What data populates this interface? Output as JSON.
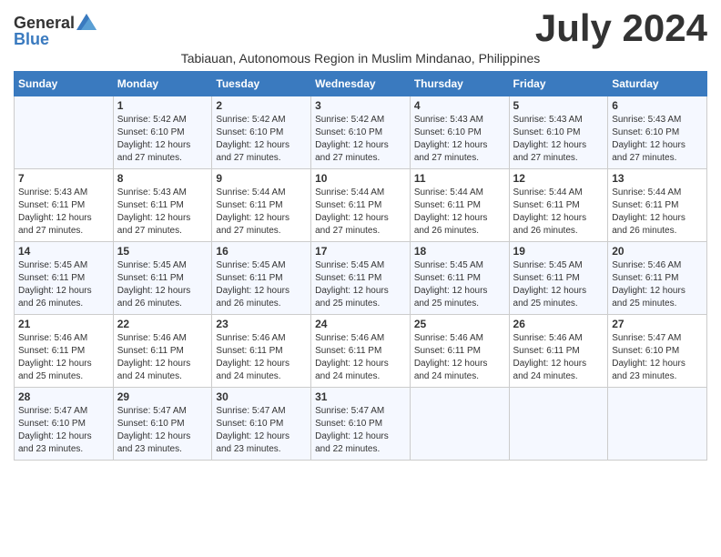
{
  "header": {
    "logo_general": "General",
    "logo_blue": "Blue",
    "month_title": "July 2024",
    "subtitle": "Tabiauan, Autonomous Region in Muslim Mindanao, Philippines"
  },
  "weekdays": [
    "Sunday",
    "Monday",
    "Tuesday",
    "Wednesday",
    "Thursday",
    "Friday",
    "Saturday"
  ],
  "weeks": [
    [
      {
        "day": "",
        "sunrise": "",
        "sunset": "",
        "daylight": ""
      },
      {
        "day": "1",
        "sunrise": "Sunrise: 5:42 AM",
        "sunset": "Sunset: 6:10 PM",
        "daylight": "Daylight: 12 hours and 27 minutes."
      },
      {
        "day": "2",
        "sunrise": "Sunrise: 5:42 AM",
        "sunset": "Sunset: 6:10 PM",
        "daylight": "Daylight: 12 hours and 27 minutes."
      },
      {
        "day": "3",
        "sunrise": "Sunrise: 5:42 AM",
        "sunset": "Sunset: 6:10 PM",
        "daylight": "Daylight: 12 hours and 27 minutes."
      },
      {
        "day": "4",
        "sunrise": "Sunrise: 5:43 AM",
        "sunset": "Sunset: 6:10 PM",
        "daylight": "Daylight: 12 hours and 27 minutes."
      },
      {
        "day": "5",
        "sunrise": "Sunrise: 5:43 AM",
        "sunset": "Sunset: 6:10 PM",
        "daylight": "Daylight: 12 hours and 27 minutes."
      },
      {
        "day": "6",
        "sunrise": "Sunrise: 5:43 AM",
        "sunset": "Sunset: 6:10 PM",
        "daylight": "Daylight: 12 hours and 27 minutes."
      }
    ],
    [
      {
        "day": "7",
        "sunrise": "Sunrise: 5:43 AM",
        "sunset": "Sunset: 6:11 PM",
        "daylight": "Daylight: 12 hours and 27 minutes."
      },
      {
        "day": "8",
        "sunrise": "Sunrise: 5:43 AM",
        "sunset": "Sunset: 6:11 PM",
        "daylight": "Daylight: 12 hours and 27 minutes."
      },
      {
        "day": "9",
        "sunrise": "Sunrise: 5:44 AM",
        "sunset": "Sunset: 6:11 PM",
        "daylight": "Daylight: 12 hours and 27 minutes."
      },
      {
        "day": "10",
        "sunrise": "Sunrise: 5:44 AM",
        "sunset": "Sunset: 6:11 PM",
        "daylight": "Daylight: 12 hours and 27 minutes."
      },
      {
        "day": "11",
        "sunrise": "Sunrise: 5:44 AM",
        "sunset": "Sunset: 6:11 PM",
        "daylight": "Daylight: 12 hours and 26 minutes."
      },
      {
        "day": "12",
        "sunrise": "Sunrise: 5:44 AM",
        "sunset": "Sunset: 6:11 PM",
        "daylight": "Daylight: 12 hours and 26 minutes."
      },
      {
        "day": "13",
        "sunrise": "Sunrise: 5:44 AM",
        "sunset": "Sunset: 6:11 PM",
        "daylight": "Daylight: 12 hours and 26 minutes."
      }
    ],
    [
      {
        "day": "14",
        "sunrise": "Sunrise: 5:45 AM",
        "sunset": "Sunset: 6:11 PM",
        "daylight": "Daylight: 12 hours and 26 minutes."
      },
      {
        "day": "15",
        "sunrise": "Sunrise: 5:45 AM",
        "sunset": "Sunset: 6:11 PM",
        "daylight": "Daylight: 12 hours and 26 minutes."
      },
      {
        "day": "16",
        "sunrise": "Sunrise: 5:45 AM",
        "sunset": "Sunset: 6:11 PM",
        "daylight": "Daylight: 12 hours and 26 minutes."
      },
      {
        "day": "17",
        "sunrise": "Sunrise: 5:45 AM",
        "sunset": "Sunset: 6:11 PM",
        "daylight": "Daylight: 12 hours and 25 minutes."
      },
      {
        "day": "18",
        "sunrise": "Sunrise: 5:45 AM",
        "sunset": "Sunset: 6:11 PM",
        "daylight": "Daylight: 12 hours and 25 minutes."
      },
      {
        "day": "19",
        "sunrise": "Sunrise: 5:45 AM",
        "sunset": "Sunset: 6:11 PM",
        "daylight": "Daylight: 12 hours and 25 minutes."
      },
      {
        "day": "20",
        "sunrise": "Sunrise: 5:46 AM",
        "sunset": "Sunset: 6:11 PM",
        "daylight": "Daylight: 12 hours and 25 minutes."
      }
    ],
    [
      {
        "day": "21",
        "sunrise": "Sunrise: 5:46 AM",
        "sunset": "Sunset: 6:11 PM",
        "daylight": "Daylight: 12 hours and 25 minutes."
      },
      {
        "day": "22",
        "sunrise": "Sunrise: 5:46 AM",
        "sunset": "Sunset: 6:11 PM",
        "daylight": "Daylight: 12 hours and 24 minutes."
      },
      {
        "day": "23",
        "sunrise": "Sunrise: 5:46 AM",
        "sunset": "Sunset: 6:11 PM",
        "daylight": "Daylight: 12 hours and 24 minutes."
      },
      {
        "day": "24",
        "sunrise": "Sunrise: 5:46 AM",
        "sunset": "Sunset: 6:11 PM",
        "daylight": "Daylight: 12 hours and 24 minutes."
      },
      {
        "day": "25",
        "sunrise": "Sunrise: 5:46 AM",
        "sunset": "Sunset: 6:11 PM",
        "daylight": "Daylight: 12 hours and 24 minutes."
      },
      {
        "day": "26",
        "sunrise": "Sunrise: 5:46 AM",
        "sunset": "Sunset: 6:11 PM",
        "daylight": "Daylight: 12 hours and 24 minutes."
      },
      {
        "day": "27",
        "sunrise": "Sunrise: 5:47 AM",
        "sunset": "Sunset: 6:10 PM",
        "daylight": "Daylight: 12 hours and 23 minutes."
      }
    ],
    [
      {
        "day": "28",
        "sunrise": "Sunrise: 5:47 AM",
        "sunset": "Sunset: 6:10 PM",
        "daylight": "Daylight: 12 hours and 23 minutes."
      },
      {
        "day": "29",
        "sunrise": "Sunrise: 5:47 AM",
        "sunset": "Sunset: 6:10 PM",
        "daylight": "Daylight: 12 hours and 23 minutes."
      },
      {
        "day": "30",
        "sunrise": "Sunrise: 5:47 AM",
        "sunset": "Sunset: 6:10 PM",
        "daylight": "Daylight: 12 hours and 23 minutes."
      },
      {
        "day": "31",
        "sunrise": "Sunrise: 5:47 AM",
        "sunset": "Sunset: 6:10 PM",
        "daylight": "Daylight: 12 hours and 22 minutes."
      },
      {
        "day": "",
        "sunrise": "",
        "sunset": "",
        "daylight": ""
      },
      {
        "day": "",
        "sunrise": "",
        "sunset": "",
        "daylight": ""
      },
      {
        "day": "",
        "sunrise": "",
        "sunset": "",
        "daylight": ""
      }
    ]
  ]
}
